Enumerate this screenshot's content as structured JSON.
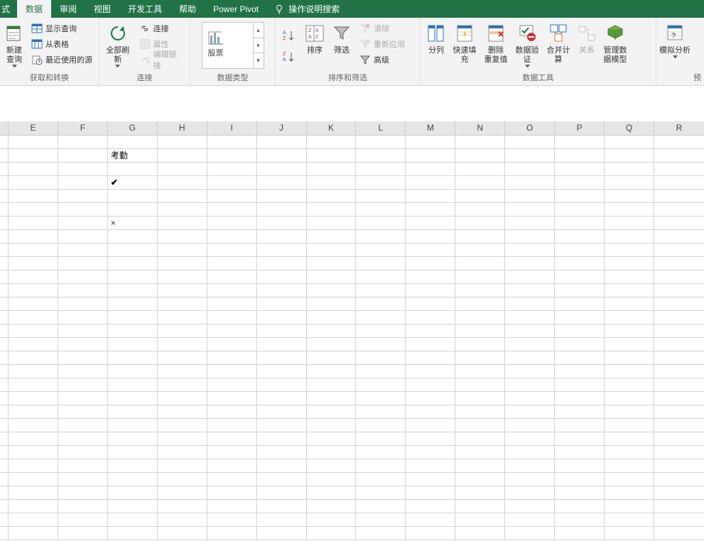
{
  "tabs": {
    "t0": "式",
    "t1": "数据",
    "t2": "审阅",
    "t3": "视图",
    "t4": "开发工具",
    "t5": "帮助",
    "t6": "Power Pivot",
    "tell_me": "操作说明搜索"
  },
  "ribbon": {
    "get_transform": {
      "new_query": "新建\n查询",
      "show_queries": "显示查询",
      "from_table": "从表格",
      "recent_sources": "最近使用的源",
      "label": "获取和转换"
    },
    "connections": {
      "refresh_all": "全部刷新",
      "connections": "连接",
      "properties": "属性",
      "edit_links": "编辑链接",
      "label": "连接"
    },
    "data_types": {
      "stocks": "股票",
      "label": "数据类型"
    },
    "sort_filter": {
      "sort": "排序",
      "filter": "筛选",
      "clear": "清除",
      "reapply": "重新应用",
      "advanced": "高级",
      "label": "排序和筛选"
    },
    "data_tools": {
      "text_to_columns": "分列",
      "flash_fill": "快速填充",
      "remove_duplicates": "删除\n重复值",
      "data_validation": "数据验\n证",
      "consolidate": "合并计算",
      "relationships": "关系",
      "manage_data_model": "管理数\n据模型",
      "label": "数据工具"
    },
    "forecast": {
      "what_if": "模拟分析",
      "label": "预"
    }
  },
  "columns": [
    "E",
    "F",
    "G",
    "H",
    "I",
    "J",
    "K",
    "L",
    "M",
    "N",
    "O",
    "P",
    "Q",
    "R"
  ],
  "grid": {
    "g_header": "考勤",
    "g_check": "✔",
    "g_x": "×"
  }
}
